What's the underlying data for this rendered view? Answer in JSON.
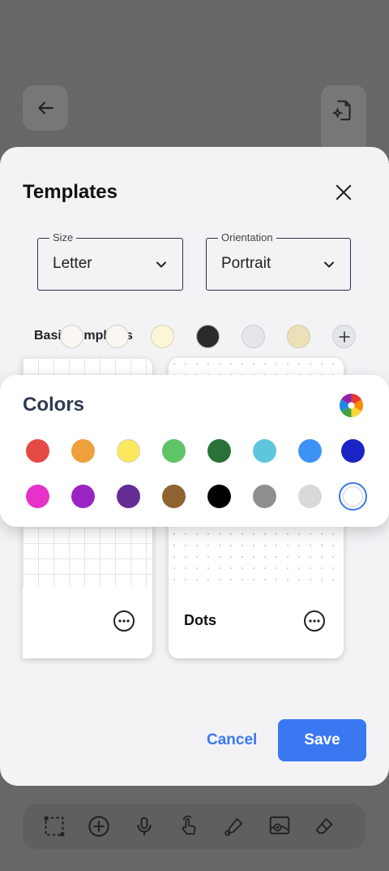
{
  "templates": {
    "title": "Templates",
    "size": {
      "label": "Size",
      "value": "Letter"
    },
    "orientation": {
      "label": "Orientation",
      "value": "Portrait"
    },
    "section_label": "Basic templates",
    "template_colors": [
      "#fbf6f2",
      "#fcf6d8",
      "#2b2b2b",
      "#e3e7ea",
      "#ebe0b8"
    ],
    "cards": [
      {
        "name": "",
        "pattern": "grid"
      },
      {
        "name": "Dots",
        "pattern": "dots"
      }
    ],
    "cancel_label": "Cancel",
    "save_label": "Save"
  },
  "colors_popup": {
    "title": "Colors",
    "row1": [
      "#e34b44",
      "#eda03b",
      "#fbe85c",
      "#5fc465",
      "#2a7139",
      "#5ec6dc",
      "#3d93f5",
      "#1a24c5"
    ],
    "row2": [
      "#e632c8",
      "#9a24c3",
      "#652c93",
      "#8e6231",
      "#000000",
      "#8f8f8f",
      "#d9d9d9",
      "#ffffff"
    ],
    "selected": "#ffffff"
  },
  "toolbar": {
    "icons": [
      "select-icon",
      "add-icon",
      "microphone-icon",
      "touch-icon",
      "pen-icon",
      "image-icon",
      "eraser-icon"
    ]
  }
}
